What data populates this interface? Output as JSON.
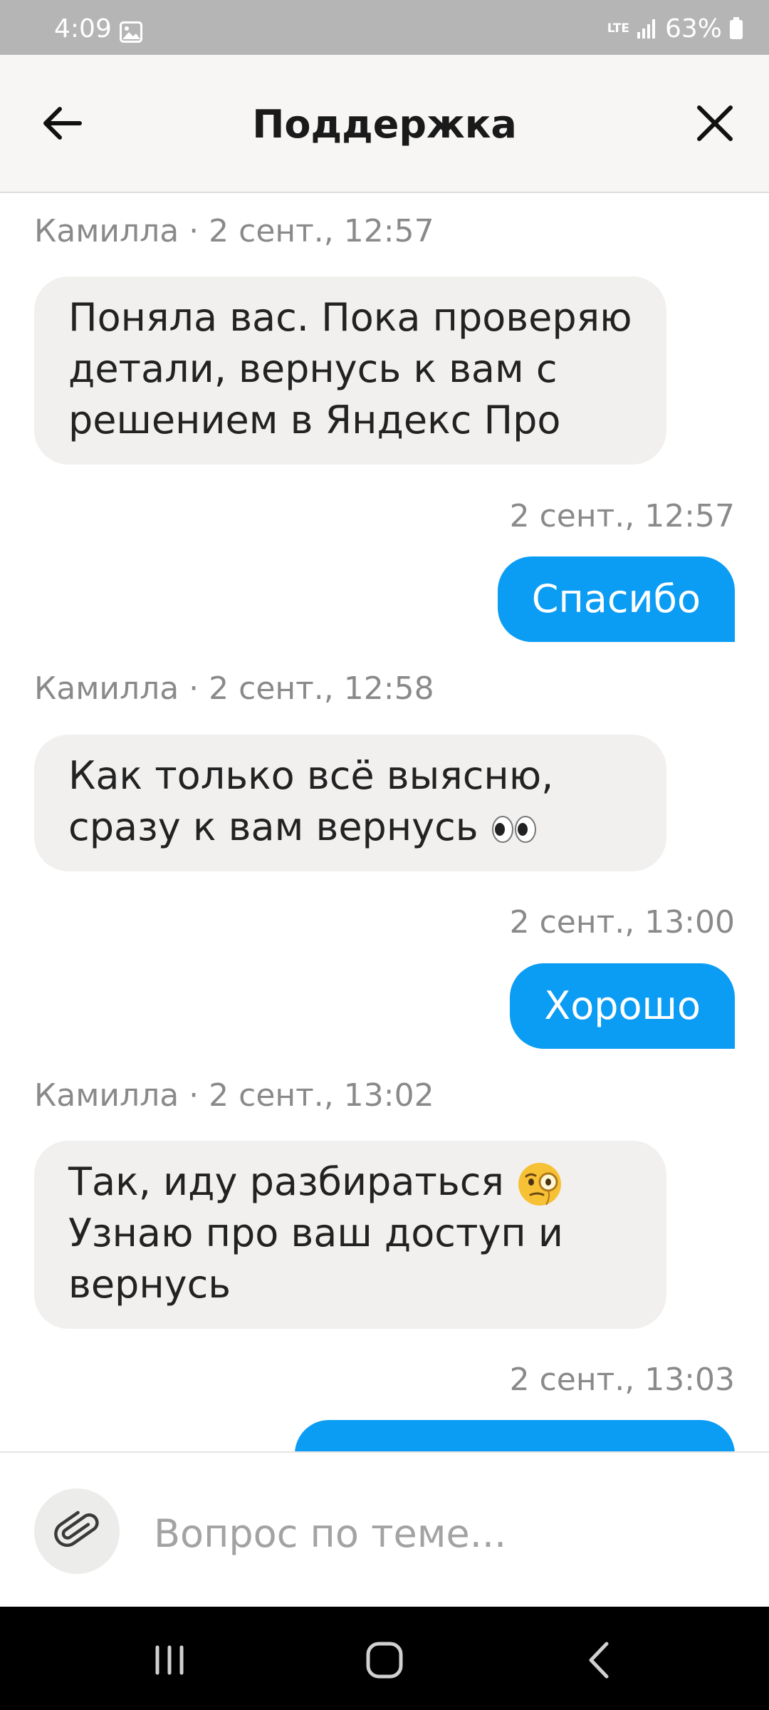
{
  "status_bar": {
    "time": "4:09",
    "network": "LTE",
    "battery": "63%"
  },
  "header": {
    "title": "Поддержка"
  },
  "messages": [
    {
      "meta": "Камилла · 2 сент., 12:57",
      "text": "Поняла вас. Пока проверяю детали, вернусь к вам с решением в Яндекс Про"
    },
    {
      "meta": "2 сент., 12:57",
      "text": "Спасибо"
    },
    {
      "meta": "Камилла · 2 сент., 12:58",
      "text": "Как только всё выясню, сразу к вам вернусь"
    },
    {
      "meta": "2 сент., 13:00",
      "text": "Хорошо"
    },
    {
      "meta": "Камилла · 2 сент., 13:02",
      "text_line1": "Так, иду разбираться",
      "text_line2": "Узнаю про ваш доступ и вернусь"
    },
    {
      "meta": "2 сент., 13:03"
    }
  ],
  "composer": {
    "placeholder": "Вопрос по теме..."
  },
  "icons": {
    "back": "arrow-left-icon",
    "close": "close-icon",
    "attach": "paperclip-icon",
    "eyes": "eyes-emoji",
    "monocle": "monocle-face-emoji"
  },
  "colors": {
    "outgoing_bubble": "#0b9cf4",
    "incoming_bubble": "#f1f0ef",
    "header_bg": "#f7f6f4"
  }
}
